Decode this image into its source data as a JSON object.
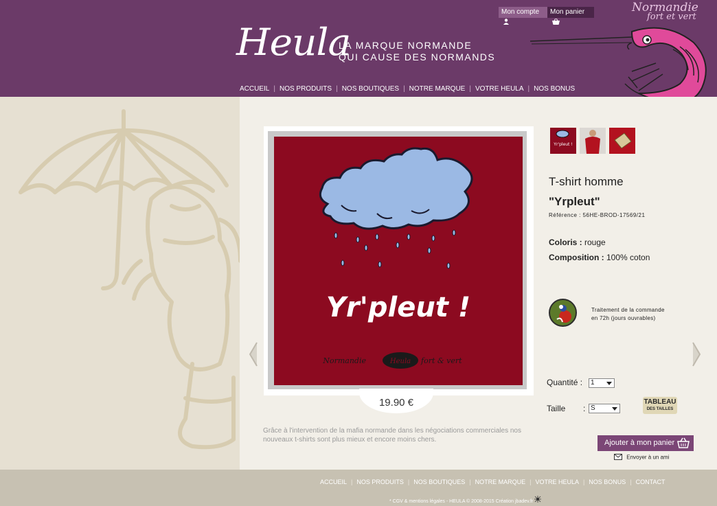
{
  "header": {
    "account_label": "Mon compte",
    "cart_label": "Mon panier",
    "logo": "Heula",
    "tagline_1": "LA MARQUE NORMANDE",
    "tagline_2": "QUI CAUSE DES NORMANDS",
    "normandie_1": "Normandie",
    "normandie_2": "fort et vert",
    "nav": [
      "ACCUEIL",
      "NOS PRODUITS",
      "NOS BOUTIQUES",
      "NOTRE MARQUE",
      "VOTRE HEULA",
      "NOS BONUS"
    ]
  },
  "product": {
    "image_text": "Yr'pleut !",
    "image_footer_left": "Normandie",
    "image_footer_center": "Heula",
    "image_footer_right": "fort & vert",
    "thumb_text": "Yr'pleut !",
    "type": "T-shirt homme",
    "name": "\"Yrpleut\"",
    "reference": "Référence : 56HE-BROD-17569/21",
    "color_label": "Coloris :",
    "color_value": "rouge",
    "composition_label": "Composition :",
    "composition_value": "100% coton",
    "processing_1": "Traitement de la commande",
    "processing_2": "en 72h (jours ouvrables)",
    "price": "19.90 €",
    "description": "Grâce à l'intervention de la mafia normande dans les négociations commerciales nos nouveaux t-shirts sont plus mieux et encore moins chers.",
    "quantity_label": "Quantité :",
    "quantity_value": "1",
    "size_label": "Taille",
    "size_colon": ":",
    "size_value": "S",
    "size_table_1": "TABLEAU",
    "size_table_2": "DES TAILLES",
    "add_to_cart": "Ajouter à mon panier",
    "send_friend": "Envoyer à un ami"
  },
  "footer": {
    "nav": [
      "ACCUEIL",
      "NOS PRODUITS",
      "NOS BOUTIQUES",
      "NOTRE MARQUE",
      "VOTRE HEULA",
      "NOS BONUS",
      "CONTACT"
    ],
    "cgv": "* CGV & mentions légales",
    "copyright": " - HEULA © 2008-2015 ",
    "credit": "Création jbadev.fr"
  },
  "colors": {
    "header": "#6b3a68",
    "shirt": "#8c0a20",
    "cloud": "#9bb9e4",
    "button": "#7b4676"
  }
}
